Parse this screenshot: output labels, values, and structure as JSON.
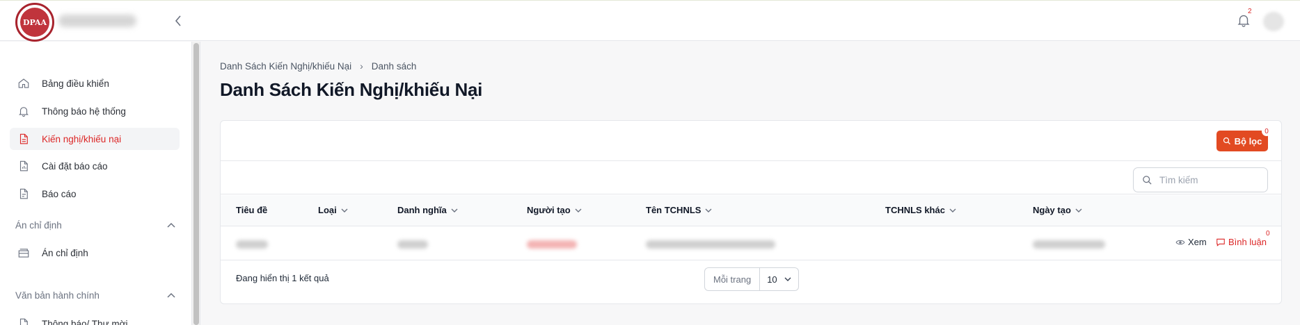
{
  "header": {
    "logo_text": "DPAA",
    "notification_count": "2"
  },
  "sidebar": {
    "items": [
      {
        "label": "Bảng điều khiển",
        "icon": "home-icon"
      },
      {
        "label": "Thông báo hệ thống",
        "icon": "bell-icon"
      },
      {
        "label": "Kiến nghị/khiếu nại",
        "icon": "document-icon"
      },
      {
        "label": "Cài đặt báo cáo",
        "icon": "report-settings-icon"
      },
      {
        "label": "Báo cáo",
        "icon": "report-icon"
      }
    ],
    "sections": [
      {
        "title": "Án chỉ định",
        "items": [
          {
            "label": "Án chỉ định",
            "icon": "archive-icon"
          }
        ]
      },
      {
        "title": "Văn bản hành chính",
        "items": [
          {
            "label": "Thông báo/ Thư mời",
            "icon": "document-icon"
          }
        ]
      }
    ]
  },
  "breadcrumb": [
    "Danh Sách Kiến Nghị/khiếu Nại",
    "Danh sách"
  ],
  "page_title": "Danh Sách Kiến Nghị/khiếu Nại",
  "toolbar": {
    "filter_label": "Bộ lọc",
    "filter_count": "0"
  },
  "search": {
    "placeholder": "Tìm kiếm"
  },
  "table": {
    "columns": [
      "Tiêu đề",
      "Loại",
      "Danh nghĩa",
      "Người tạo",
      "Tên TCHNLS",
      "TCHNLS khác",
      "Ngày tạo"
    ],
    "actions": {
      "view": "Xem",
      "comment": "Bình luận",
      "comment_count": "0"
    }
  },
  "footer": {
    "result_text": "Đang hiển thị 1 kết quả",
    "per_page_label": "Mỗi trang",
    "per_page_value": "10"
  },
  "colors": {
    "accent": "#e24a22",
    "active": "#dc2626"
  }
}
